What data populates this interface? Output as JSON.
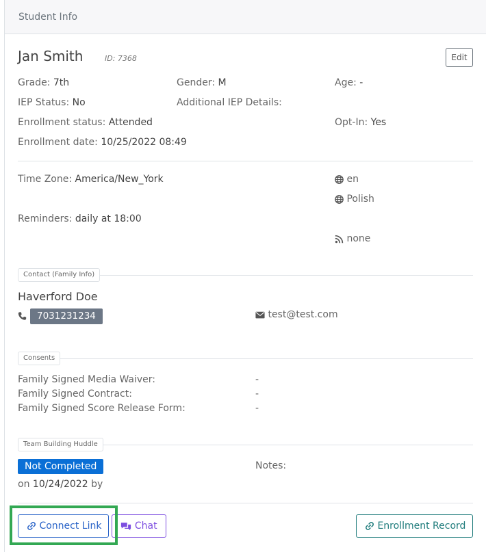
{
  "header": {
    "title": "Student Info"
  },
  "student": {
    "name": "Jan Smith",
    "id_text": "ID: 7368",
    "edit_label": "Edit",
    "grade_label": "Grade:",
    "grade": "7th",
    "gender_label": "Gender:",
    "gender": "M",
    "age_label": "Age:",
    "age": "-",
    "iep_status_label": "IEP Status:",
    "iep_status": "No",
    "additional_iep_label": "Additional IEP Details:",
    "enrollment_status_label": "Enrollment status:",
    "enrollment_status": "Attended",
    "opt_in_label": "Opt-In:",
    "opt_in": "Yes",
    "enrollment_date_label": "Enrollment date:",
    "enrollment_date": "10/25/2022 08:49"
  },
  "preferences": {
    "timezone_label": "Time Zone:",
    "timezone": "America/New_York",
    "language1": "en",
    "language2": "Polish",
    "reminders_label": "Reminders:",
    "reminders": "daily at 18:00",
    "feed": "none"
  },
  "contact": {
    "legend": "Contact (Family Info)",
    "name": "Haverford Doe",
    "phone": "7031231234",
    "email": "test@test.com"
  },
  "consents": {
    "legend": "Consents",
    "items": [
      {
        "label": "Family Signed Media Waiver:",
        "value": "-"
      },
      {
        "label": "Family Signed Contract:",
        "value": "-"
      },
      {
        "label": "Family Signed Score Release Form:",
        "value": "-"
      }
    ]
  },
  "huddle": {
    "legend": "Team Building Huddle",
    "status": "Not Completed",
    "date_prefix": "on",
    "date": "10/24/2022",
    "date_suffix": "by",
    "notes_label": "Notes:"
  },
  "actions": {
    "connect_link": "Connect Link",
    "chat": "Chat",
    "enrollment_record": "Enrollment Record"
  },
  "colors": {
    "connect": "#2a64c8",
    "chat": "#7d4ee0",
    "enrollment": "#1e7b7b",
    "status_badge": "#0a6fd6",
    "phone_badge": "#6c7786",
    "highlight": "#33a853"
  }
}
